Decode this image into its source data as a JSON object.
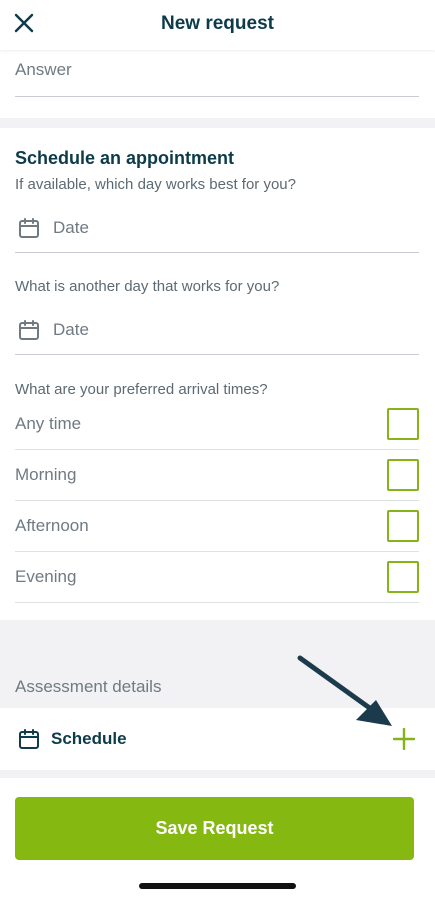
{
  "header": {
    "title": "New request"
  },
  "answer": {
    "placeholder": "Answer"
  },
  "schedule": {
    "title": "Schedule an appointment",
    "q1": "If available, which day works best for you?",
    "date1": "Date",
    "q2": "What is another day that works for you?",
    "date2": "Date",
    "q3": "What are your preferred arrival times?",
    "options": [
      {
        "label": "Any time",
        "checked": false
      },
      {
        "label": "Morning",
        "checked": false
      },
      {
        "label": "Afternoon",
        "checked": false
      },
      {
        "label": "Evening",
        "checked": false
      }
    ]
  },
  "assessment": {
    "heading": "Assessment details",
    "schedule_label": "Schedule"
  },
  "footer": {
    "save_label": "Save Request"
  },
  "colors": {
    "accent": "#86b812",
    "text_dark": "#0d3b4a",
    "text_muted": "#6f7a83",
    "arrow": "#1b3a4b"
  }
}
